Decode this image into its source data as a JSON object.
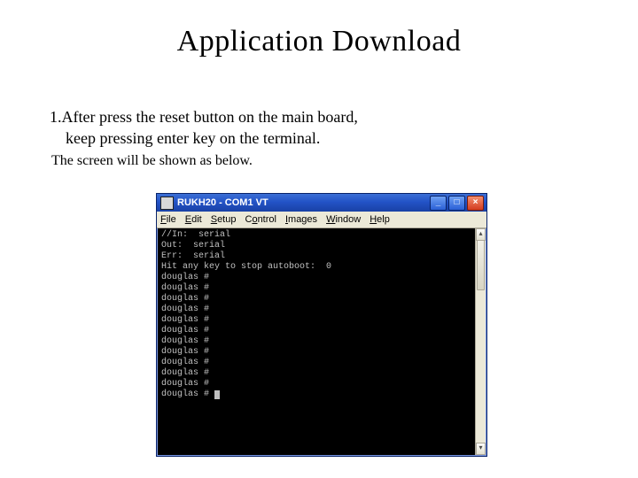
{
  "slide": {
    "title": "Application Download",
    "line1": "1.After press the reset button on the main board,",
    "line2": "keep pressing enter key on the terminal.",
    "line3": "The screen will be shown as below."
  },
  "window": {
    "title": "RUKH20 - COM1 VT",
    "menu": {
      "file": "File",
      "edit": "Edit",
      "setup": "Setup",
      "control": "Control",
      "images": "Images",
      "window": "Window",
      "help": "Help"
    },
    "buttons": {
      "min": "_",
      "max": "□",
      "close": "×"
    },
    "terminal_lines": [
      "//In:  serial",
      "Out:  serial",
      "Err:  serial",
      "Hit any key to stop autoboot:  0",
      "douglas #",
      "douglas #",
      "douglas #",
      "douglas #",
      "douglas #",
      "douglas #",
      "douglas #",
      "douglas #",
      "douglas #",
      "douglas #",
      "douglas #",
      "douglas # "
    ]
  }
}
